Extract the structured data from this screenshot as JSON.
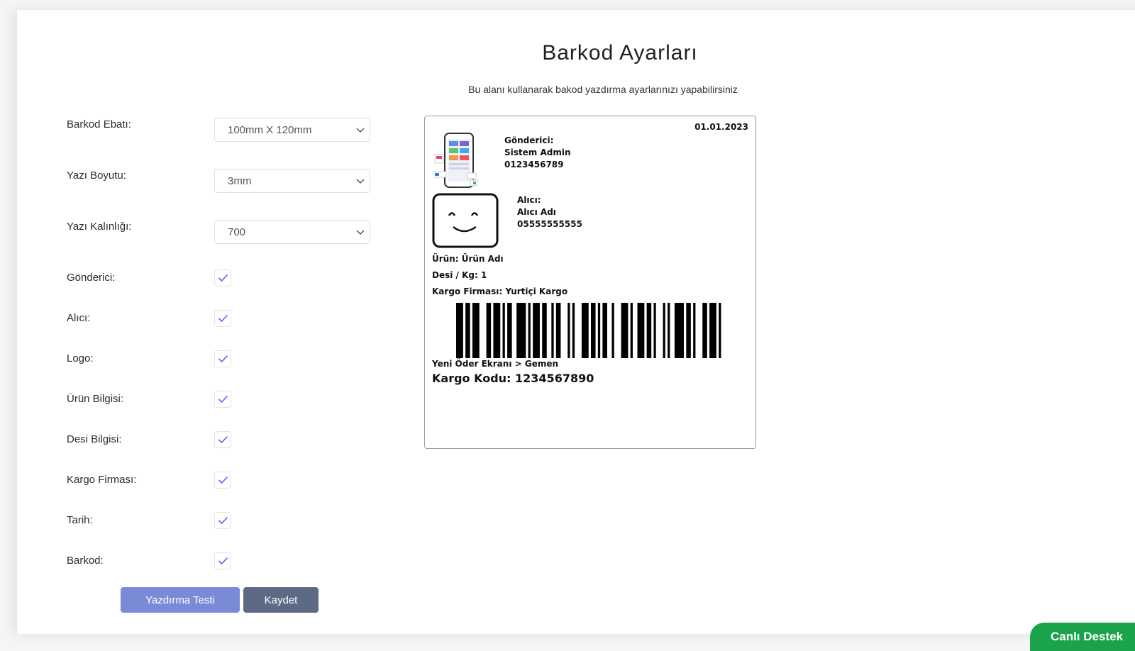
{
  "page": {
    "title": "Barkod Ayarları",
    "subtitle": "Bu alanı kullanarak bakod yazdırma ayarlarınızı yapabilirsiniz"
  },
  "settings": {
    "barcode_size": {
      "label": "Barkod Ebatı:",
      "value": "100mm X 120mm"
    },
    "font_size": {
      "label": "Yazı Boyutu:",
      "value": "3mm"
    },
    "font_weight": {
      "label": "Yazı Kalınlığı:",
      "value": "700"
    },
    "checkboxes": [
      {
        "label": "Gönderici:",
        "checked": true
      },
      {
        "label": "Alıcı:",
        "checked": true
      },
      {
        "label": "Logo:",
        "checked": true
      },
      {
        "label": "Ürün Bilgisi:",
        "checked": true
      },
      {
        "label": "Desi Bilgisi:",
        "checked": true
      },
      {
        "label": "Kargo Firması:",
        "checked": true
      },
      {
        "label": "Tarih:",
        "checked": true
      },
      {
        "label": "Barkod:",
        "checked": true
      }
    ]
  },
  "buttons": {
    "print_test": "Yazdırma Testi",
    "save": "Kaydet"
  },
  "preview": {
    "date": "01.01.2023",
    "sender_title": "Gönderici:",
    "sender_name": "Sistem Admin",
    "sender_phone": "0123456789",
    "receiver_title": "Alıcı:",
    "receiver_name": "Alıcı Adı",
    "receiver_phone": "05555555555",
    "product": "Ürün: Ürün Adı",
    "desi": "Desi / Kg: 1",
    "cargo_company": "Kargo Firması: Yurtiçi Kargo",
    "route": "Yeni Öder Ekranı > Gemen",
    "cargo_code": "Kargo Kodu: 1234567890"
  },
  "support": {
    "label": "Canlı Destek"
  },
  "colors": {
    "accent_check": "#7c4dff",
    "print_test_button": "#7b8ad6",
    "save_button": "#5d6a86",
    "support_green": "#1aa34a"
  }
}
